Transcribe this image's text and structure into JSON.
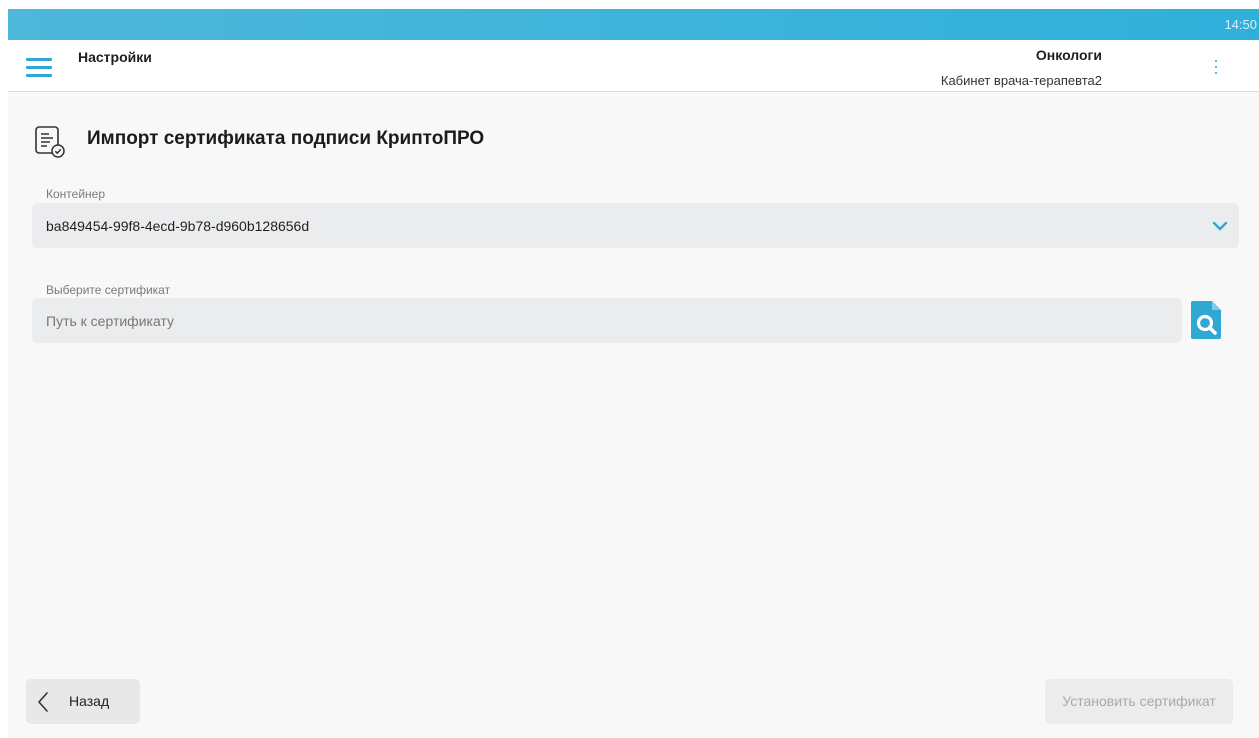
{
  "status_bar": {
    "time": "14:50",
    "color": "#36b1db"
  },
  "topbar": {
    "title": "Настройки",
    "org_name": "Онкологи",
    "org_subtitle": "Кабинет врача-терапевта2",
    "menu_icon": "hamburger-menu-icon",
    "more_icon": "more-vertical-icon"
  },
  "section": {
    "icon": "certificate-document-icon",
    "title": "Импорт сертификата подписи КриптоПРО"
  },
  "container_field": {
    "label": "Контейнер",
    "value": "ba849454-99f8-4ecd-9b78-d960b128656d",
    "icon": "chevron-down-icon"
  },
  "certificate_field": {
    "label": "Выберите сертификат",
    "value": "",
    "placeholder": "Путь к сертификату",
    "browse_icon": "file-search-icon"
  },
  "footer": {
    "back_label": "Назад",
    "back_icon": "chevron-left-icon",
    "install_label": "Установить сертификат",
    "install_enabled": false
  },
  "colors": {
    "accent": "#2fa8d3",
    "background": "#f8f8f8",
    "field_background": "#ebecee",
    "disabled_text": "#a9a9a9"
  }
}
